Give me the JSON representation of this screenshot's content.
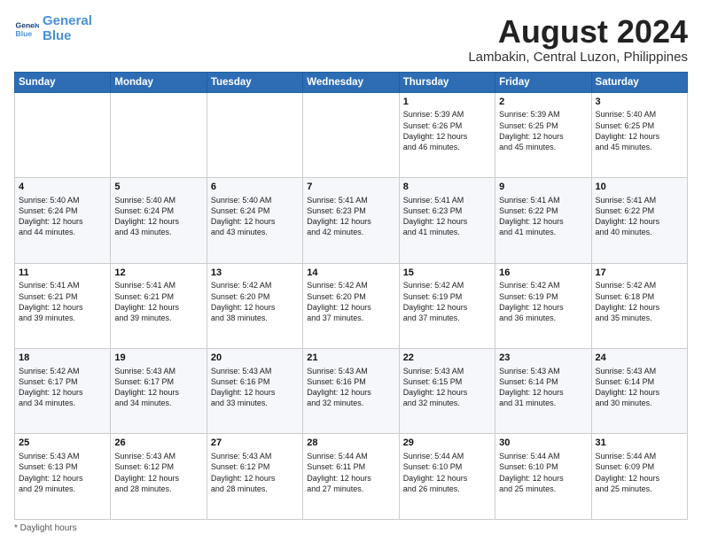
{
  "header": {
    "logo_line1": "General",
    "logo_line2": "Blue",
    "month": "August 2024",
    "location": "Lambakin, Central Luzon, Philippines"
  },
  "days_of_week": [
    "Sunday",
    "Monday",
    "Tuesday",
    "Wednesday",
    "Thursday",
    "Friday",
    "Saturday"
  ],
  "weeks": [
    [
      {
        "day": "",
        "info": ""
      },
      {
        "day": "",
        "info": ""
      },
      {
        "day": "",
        "info": ""
      },
      {
        "day": "",
        "info": ""
      },
      {
        "day": "1",
        "info": "Sunrise: 5:39 AM\nSunset: 6:26 PM\nDaylight: 12 hours\nand 46 minutes."
      },
      {
        "day": "2",
        "info": "Sunrise: 5:39 AM\nSunset: 6:25 PM\nDaylight: 12 hours\nand 45 minutes."
      },
      {
        "day": "3",
        "info": "Sunrise: 5:40 AM\nSunset: 6:25 PM\nDaylight: 12 hours\nand 45 minutes."
      }
    ],
    [
      {
        "day": "4",
        "info": "Sunrise: 5:40 AM\nSunset: 6:24 PM\nDaylight: 12 hours\nand 44 minutes."
      },
      {
        "day": "5",
        "info": "Sunrise: 5:40 AM\nSunset: 6:24 PM\nDaylight: 12 hours\nand 43 minutes."
      },
      {
        "day": "6",
        "info": "Sunrise: 5:40 AM\nSunset: 6:24 PM\nDaylight: 12 hours\nand 43 minutes."
      },
      {
        "day": "7",
        "info": "Sunrise: 5:41 AM\nSunset: 6:23 PM\nDaylight: 12 hours\nand 42 minutes."
      },
      {
        "day": "8",
        "info": "Sunrise: 5:41 AM\nSunset: 6:23 PM\nDaylight: 12 hours\nand 41 minutes."
      },
      {
        "day": "9",
        "info": "Sunrise: 5:41 AM\nSunset: 6:22 PM\nDaylight: 12 hours\nand 41 minutes."
      },
      {
        "day": "10",
        "info": "Sunrise: 5:41 AM\nSunset: 6:22 PM\nDaylight: 12 hours\nand 40 minutes."
      }
    ],
    [
      {
        "day": "11",
        "info": "Sunrise: 5:41 AM\nSunset: 6:21 PM\nDaylight: 12 hours\nand 39 minutes."
      },
      {
        "day": "12",
        "info": "Sunrise: 5:41 AM\nSunset: 6:21 PM\nDaylight: 12 hours\nand 39 minutes."
      },
      {
        "day": "13",
        "info": "Sunrise: 5:42 AM\nSunset: 6:20 PM\nDaylight: 12 hours\nand 38 minutes."
      },
      {
        "day": "14",
        "info": "Sunrise: 5:42 AM\nSunset: 6:20 PM\nDaylight: 12 hours\nand 37 minutes."
      },
      {
        "day": "15",
        "info": "Sunrise: 5:42 AM\nSunset: 6:19 PM\nDaylight: 12 hours\nand 37 minutes."
      },
      {
        "day": "16",
        "info": "Sunrise: 5:42 AM\nSunset: 6:19 PM\nDaylight: 12 hours\nand 36 minutes."
      },
      {
        "day": "17",
        "info": "Sunrise: 5:42 AM\nSunset: 6:18 PM\nDaylight: 12 hours\nand 35 minutes."
      }
    ],
    [
      {
        "day": "18",
        "info": "Sunrise: 5:42 AM\nSunset: 6:17 PM\nDaylight: 12 hours\nand 34 minutes."
      },
      {
        "day": "19",
        "info": "Sunrise: 5:43 AM\nSunset: 6:17 PM\nDaylight: 12 hours\nand 34 minutes."
      },
      {
        "day": "20",
        "info": "Sunrise: 5:43 AM\nSunset: 6:16 PM\nDaylight: 12 hours\nand 33 minutes."
      },
      {
        "day": "21",
        "info": "Sunrise: 5:43 AM\nSunset: 6:16 PM\nDaylight: 12 hours\nand 32 minutes."
      },
      {
        "day": "22",
        "info": "Sunrise: 5:43 AM\nSunset: 6:15 PM\nDaylight: 12 hours\nand 32 minutes."
      },
      {
        "day": "23",
        "info": "Sunrise: 5:43 AM\nSunset: 6:14 PM\nDaylight: 12 hours\nand 31 minutes."
      },
      {
        "day": "24",
        "info": "Sunrise: 5:43 AM\nSunset: 6:14 PM\nDaylight: 12 hours\nand 30 minutes."
      }
    ],
    [
      {
        "day": "25",
        "info": "Sunrise: 5:43 AM\nSunset: 6:13 PM\nDaylight: 12 hours\nand 29 minutes."
      },
      {
        "day": "26",
        "info": "Sunrise: 5:43 AM\nSunset: 6:12 PM\nDaylight: 12 hours\nand 28 minutes."
      },
      {
        "day": "27",
        "info": "Sunrise: 5:43 AM\nSunset: 6:12 PM\nDaylight: 12 hours\nand 28 minutes."
      },
      {
        "day": "28",
        "info": "Sunrise: 5:44 AM\nSunset: 6:11 PM\nDaylight: 12 hours\nand 27 minutes."
      },
      {
        "day": "29",
        "info": "Sunrise: 5:44 AM\nSunset: 6:10 PM\nDaylight: 12 hours\nand 26 minutes."
      },
      {
        "day": "30",
        "info": "Sunrise: 5:44 AM\nSunset: 6:10 PM\nDaylight: 12 hours\nand 25 minutes."
      },
      {
        "day": "31",
        "info": "Sunrise: 5:44 AM\nSunset: 6:09 PM\nDaylight: 12 hours\nand 25 minutes."
      }
    ]
  ],
  "footer": {
    "note": "Daylight hours"
  }
}
